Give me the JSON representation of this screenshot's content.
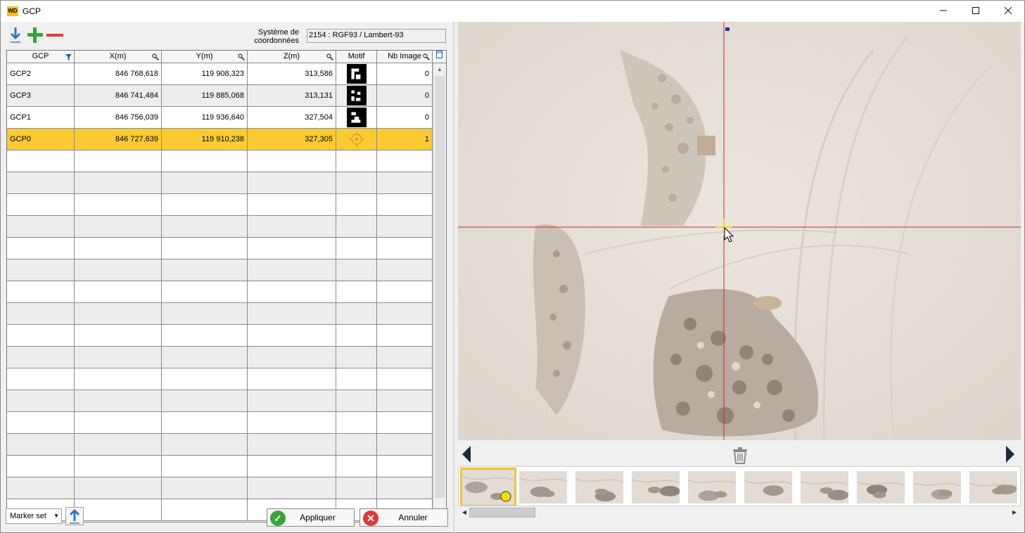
{
  "window": {
    "title": "GCP",
    "app_icon_text": "WD"
  },
  "toolbar": {
    "import_icon": "download-arrow-icon",
    "add_icon": "plus-icon",
    "remove_icon": "minus-icon",
    "coord_label_line1": "Système de",
    "coord_label_line2": "coordonnées",
    "coord_value": "2154 : RGF93 / Lambert-93"
  },
  "table": {
    "columns": [
      "GCP",
      "X(m)",
      "Y(m)",
      "Z(m)",
      "Motif",
      "Nb Image"
    ],
    "rows": [
      {
        "gcp": "GCP2",
        "x": "846 768,618",
        "y": "119 908,323",
        "z": "313,586",
        "motif": "marker-pattern-a",
        "nb": "0"
      },
      {
        "gcp": "GCP3",
        "x": "846 741,484",
        "y": "119 885,068",
        "z": "313,131",
        "motif": "marker-pattern-b",
        "nb": "0"
      },
      {
        "gcp": "GCP1",
        "x": "846 756,039",
        "y": "119 936,640",
        "z": "327,504",
        "motif": "marker-pattern-c",
        "nb": "0"
      },
      {
        "gcp": "GCP0",
        "x": "846 727,639",
        "y": "119 910,238",
        "z": "327,305",
        "motif": "target-crosshair-icon",
        "nb": "1"
      }
    ],
    "selected_row": 3,
    "selected_color": "#fccb31"
  },
  "bottom": {
    "marker_set_label": "Marker set",
    "apply_label": "Appliquer",
    "cancel_label": "Annuler"
  },
  "viewer": {
    "crosshair_color": "#e02020",
    "thumbnail_count": 10,
    "selected_thumbnail": 0
  }
}
